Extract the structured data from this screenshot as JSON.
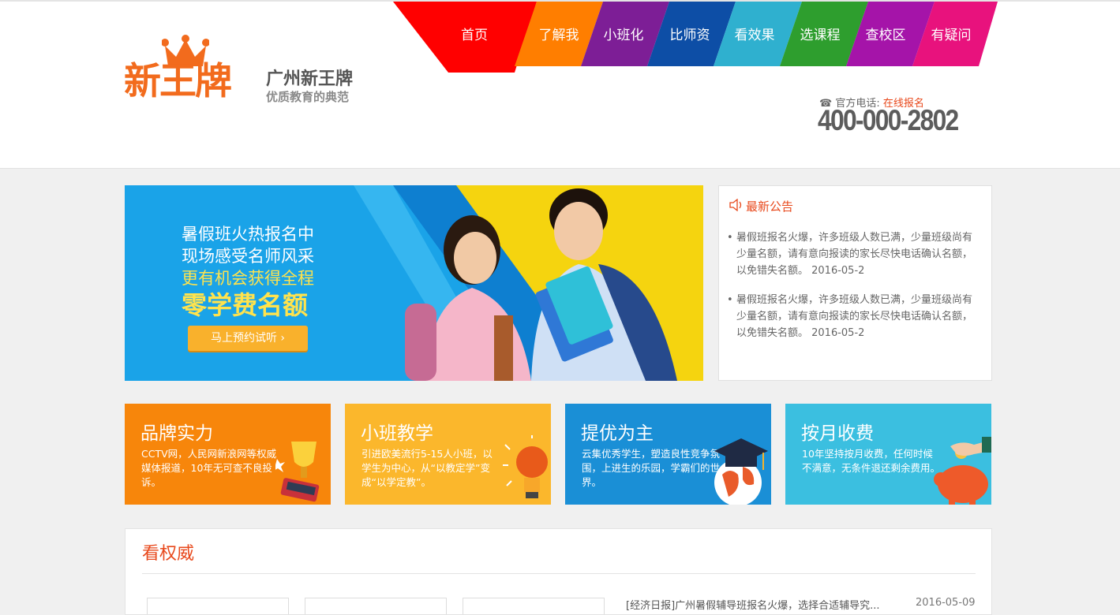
{
  "brand": {
    "logo_text": "新王牌",
    "title": "广州新王牌",
    "subtitle": "优质教育的典范"
  },
  "nav": {
    "items": [
      {
        "label": "首页",
        "color": "#ff0000"
      },
      {
        "label": "了解我",
        "color": "#ff7e00"
      },
      {
        "label": "小班化",
        "color": "#7d1e96"
      },
      {
        "label": "比师资",
        "color": "#0d4ea6"
      },
      {
        "label": "看效果",
        "color": "#2fb0cf"
      },
      {
        "label": "选课程",
        "color": "#2e9e2e"
      },
      {
        "label": "查校区",
        "color": "#a514a9"
      },
      {
        "label": "有疑问",
        "color": "#e8127d"
      }
    ]
  },
  "contact": {
    "label": "官方电话:",
    "online": "在线报名",
    "phone": "400-000-2802",
    "phone_icon": "phone-icon"
  },
  "banner": {
    "line1": "暑假班火热报名中",
    "line2": "现场感受名师风采",
    "line3": "更有机会获得全程",
    "line4": "零学费名额",
    "button": "马上预约试听  ›"
  },
  "notice": {
    "title": "最新公告",
    "icon": "speaker-icon",
    "items": [
      {
        "text": "暑假班报名火爆，许多班级人数已满，少量班级尚有少量名额，请有意向报读的家长尽快电话确认名额，以免错失名额。 2016-05-2"
      },
      {
        "text": "暑假班报名火爆，许多班级人数已满，少量班级尚有少量名额，请有意向报读的家长尽快电话确认名额，以免错失名额。 2016-05-2"
      }
    ]
  },
  "features": [
    {
      "title": "品牌实力",
      "desc": "CCTV网，人民网新浪网等权威媒体报道，10年无可查不良投诉。",
      "color": "#f7860b",
      "icon": "trophy-icon"
    },
    {
      "title": "小班教学",
      "desc": "引进欧美流行5-15人小班，以学生为中心，从“以教定学”变成“以学定教”。",
      "color": "#fbb72c",
      "icon": "lightbulb-icon"
    },
    {
      "title": "提优为主",
      "desc": "云集优秀学生，塑造良性竞争氛围，上进生的乐园，学霸们的世界。",
      "color": "#1a8fd6",
      "icon": "graduation-cap-icon"
    },
    {
      "title": "按月收费",
      "desc": "10年坚持按月收费，任何时候不满意，无条件退还剩余费用。",
      "color": "#3bbfe0",
      "icon": "piggy-bank-icon"
    }
  ],
  "authority": {
    "title": "看权威",
    "news": "[经济日报]广州暑假辅导班报名火爆，选择合适辅导究...",
    "date": "2016-05-09"
  }
}
